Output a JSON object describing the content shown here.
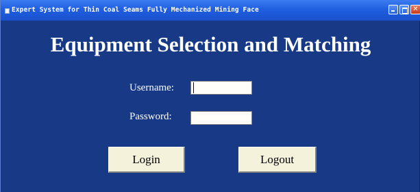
{
  "window": {
    "title": "Expert System for Thin Coal Seams Fully Mechanized Mining Face"
  },
  "form": {
    "heading": "Equipment Selection and Matching",
    "username_label": "Username:",
    "username_value": "",
    "password_label": "Password:",
    "password_value": "",
    "login_label": "Login",
    "logout_label": "Logout"
  },
  "colors": {
    "background": "#183a86",
    "titlebar": "#1f5fe0",
    "button_face": "#f5f2dc"
  },
  "icons": {
    "app": "app-icon",
    "minimize": "minimize-icon",
    "maximize": "maximize-icon",
    "close": "close-icon"
  }
}
